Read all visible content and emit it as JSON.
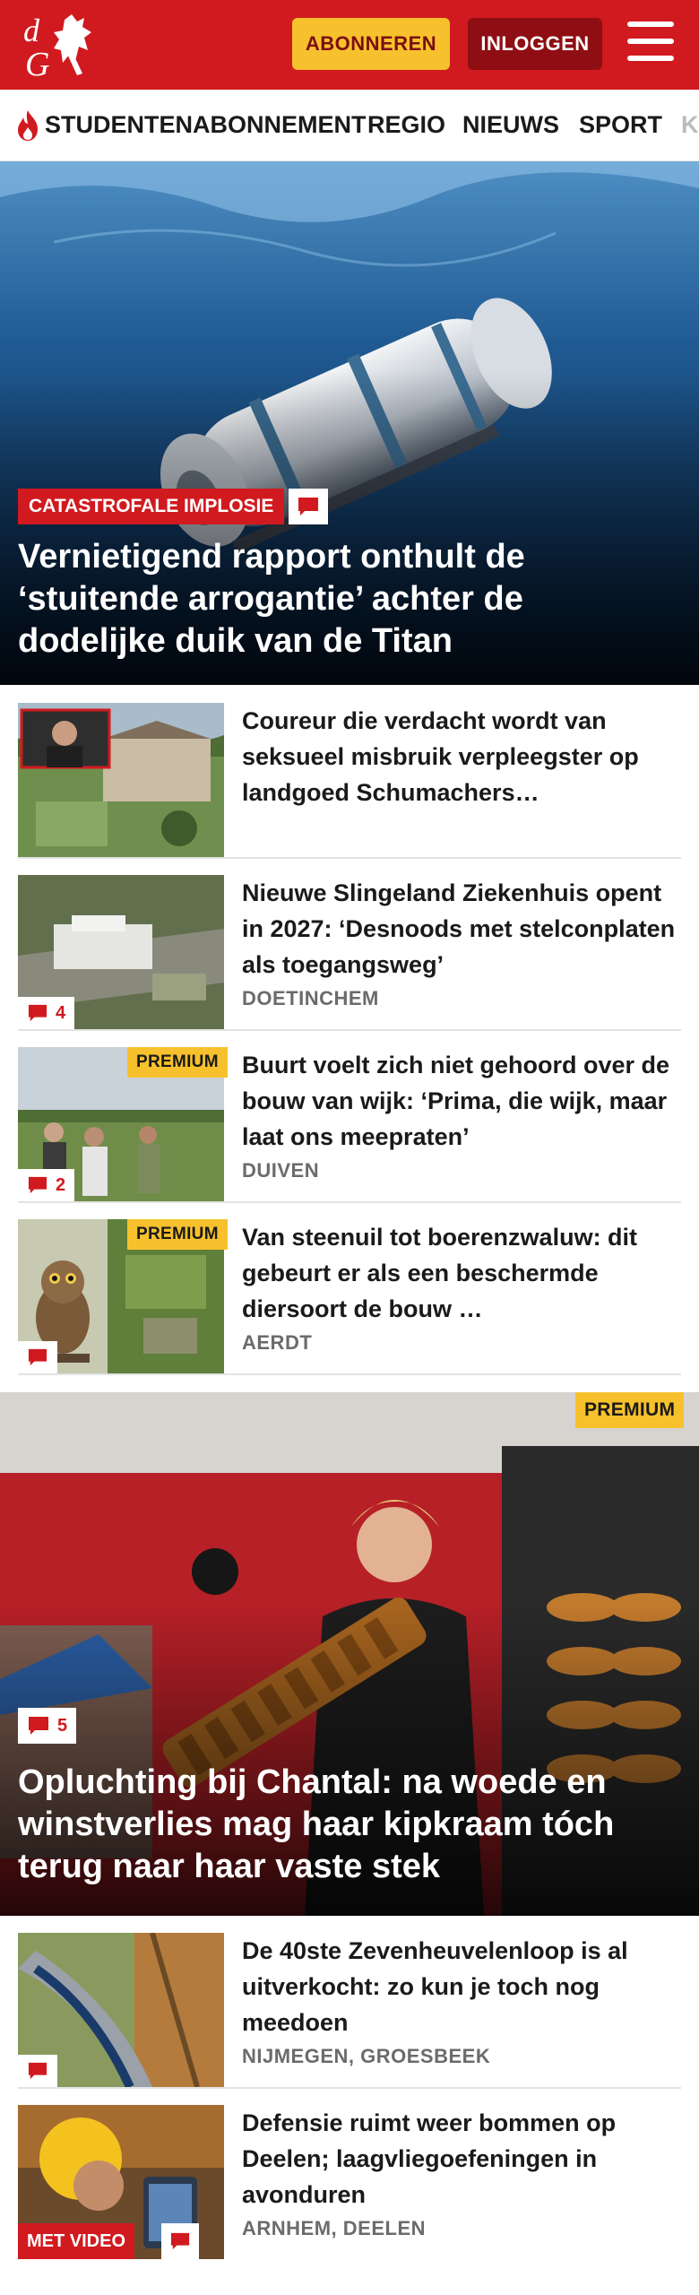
{
  "header": {
    "logo_text": "dG",
    "subscribe_label": "ABONNEREN",
    "login_label": "INLOGGEN"
  },
  "nav": {
    "items": [
      "STUDENTENABONNEMENT",
      "REGIO",
      "NIEUWS",
      "SPORT",
      "K"
    ]
  },
  "hero1": {
    "kicker": "CATASTROFALE IMPLOSIE",
    "title": "Vernietigend rapport onthult de ‘stuitende arrogantie’ achter de dodelijke duik van de Titan"
  },
  "articles": [
    {
      "title": "Coureur die verdacht wordt van seksueel misbruik verpleegster op landgoed Schumachers…",
      "location": "",
      "comments": "",
      "premium": ""
    },
    {
      "title": "Nieuwe Slingeland Ziekenhuis opent in 2027: ‘Desnoods met stelconplaten als toegangsweg’",
      "location": "DOETINCHEM",
      "comments": "4",
      "premium": ""
    },
    {
      "title": "Buurt voelt zich niet gehoord over de bouw van wijk: ‘Prima, die wijk, maar laat ons meepraten’",
      "location": "DUIVEN",
      "comments": "2",
      "premium": "PREMIUM"
    },
    {
      "title": "Van steenuil tot boerenzwaluw: dit gebeurt er als een beschermde diersoort de bouw …",
      "location": "AERDT",
      "comments": "",
      "premium": "PREMIUM"
    }
  ],
  "hero2": {
    "premium": "PREMIUM",
    "comments": "5",
    "title": "Opluchting bij Chantal: na woede en winstverlies mag haar kipkraam tóch terug naar haar vaste stek"
  },
  "articles2": [
    {
      "title": "De 40ste Zevenheuvelenloop is al uitverkocht: zo kun je toch nog meedoen",
      "location": "NIJMEGEN, GROESBEEK"
    },
    {
      "title": "Defensie ruimt weer bommen op Deelen; laagvliegoefeningen in avonduren",
      "location": "ARNHEM, DEELEN",
      "video": "MET VIDEO"
    }
  ],
  "colors": {
    "brand_red": "#d11a1f",
    "premium_yellow": "#f7c12d",
    "login_dark_red": "#8e0e13"
  },
  "icons": [
    "flame-icon",
    "comment-icon",
    "menu-icon",
    "logo-knight-icon"
  ]
}
